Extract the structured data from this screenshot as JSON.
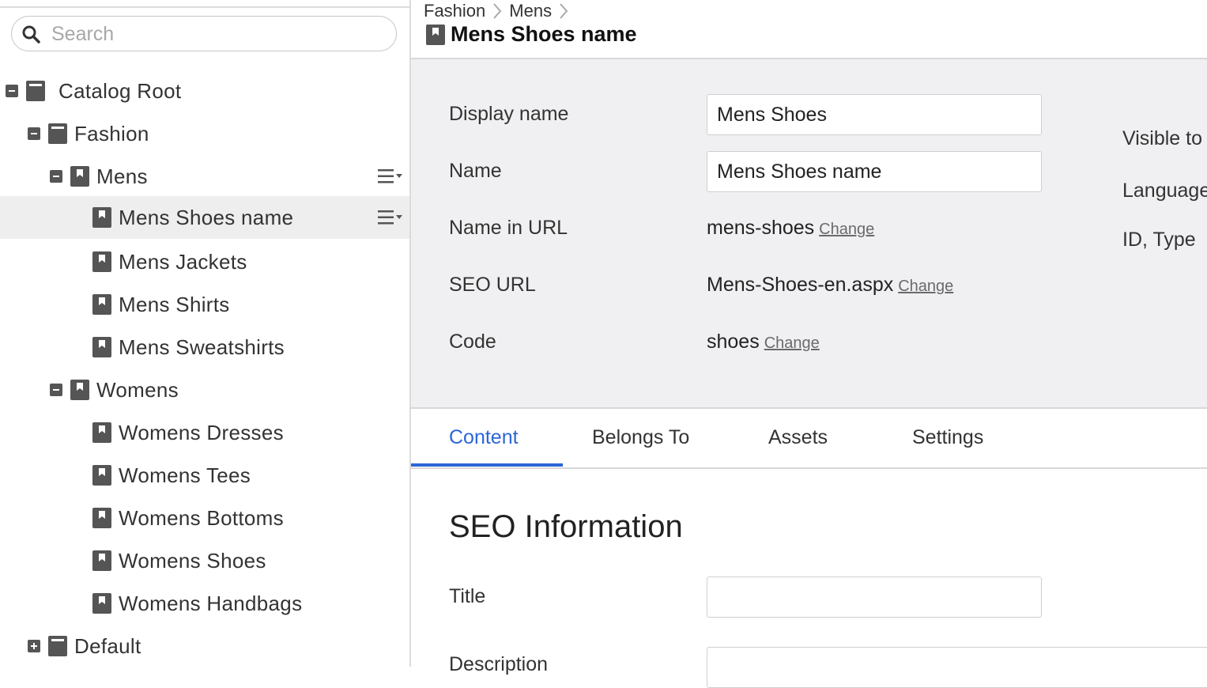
{
  "search": {
    "placeholder": "Search",
    "icon": "search-icon"
  },
  "tree": {
    "nodes": [
      {
        "label": "Catalog Root",
        "toggle": "minus"
      },
      {
        "label": "Fashion",
        "toggle": "minus"
      },
      {
        "label": "Mens",
        "toggle": "minus"
      },
      {
        "label": "Mens Shoes name",
        "selected": true
      },
      {
        "label": "Mens Jackets"
      },
      {
        "label": "Mens Shirts"
      },
      {
        "label": "Mens Sweatshirts"
      },
      {
        "label": "Womens",
        "toggle": "minus"
      },
      {
        "label": "Womens Dresses"
      },
      {
        "label": "Womens Tees"
      },
      {
        "label": "Womens Bottoms"
      },
      {
        "label": "Womens Shoes"
      },
      {
        "label": "Womens Handbags"
      },
      {
        "label": "Default",
        "toggle": "plus"
      }
    ]
  },
  "breadcrumb": {
    "items": [
      "Fashion",
      "Mens"
    ]
  },
  "page": {
    "title": "Mens Shoes name"
  },
  "properties": {
    "display_name": {
      "label": "Display name",
      "value": "Mens Shoes"
    },
    "name": {
      "label": "Name",
      "value": "Mens Shoes name"
    },
    "name_in_url": {
      "label": "Name in URL",
      "value": "mens-shoes",
      "link": "Change"
    },
    "seo_url": {
      "label": "SEO URL",
      "value": "Mens-Shoes-en.aspx",
      "link": "Change"
    },
    "code": {
      "label": "Code",
      "value": "shoes",
      "link": "Change"
    },
    "side": {
      "visible_to": "Visible to",
      "languages": "Languages",
      "id_type": "ID, Type"
    }
  },
  "tabs": [
    {
      "label": "Content",
      "active": true
    },
    {
      "label": "Belongs To"
    },
    {
      "label": "Assets"
    },
    {
      "label": "Settings"
    }
  ],
  "seo": {
    "section_title": "SEO Information",
    "title_label": "Title",
    "description_label": "Description",
    "title_value": "",
    "description_value": ""
  },
  "colors": {
    "accent": "#2a66d9",
    "selected_row": "#eeeeef",
    "panel_bg": "#f0f0f2"
  }
}
